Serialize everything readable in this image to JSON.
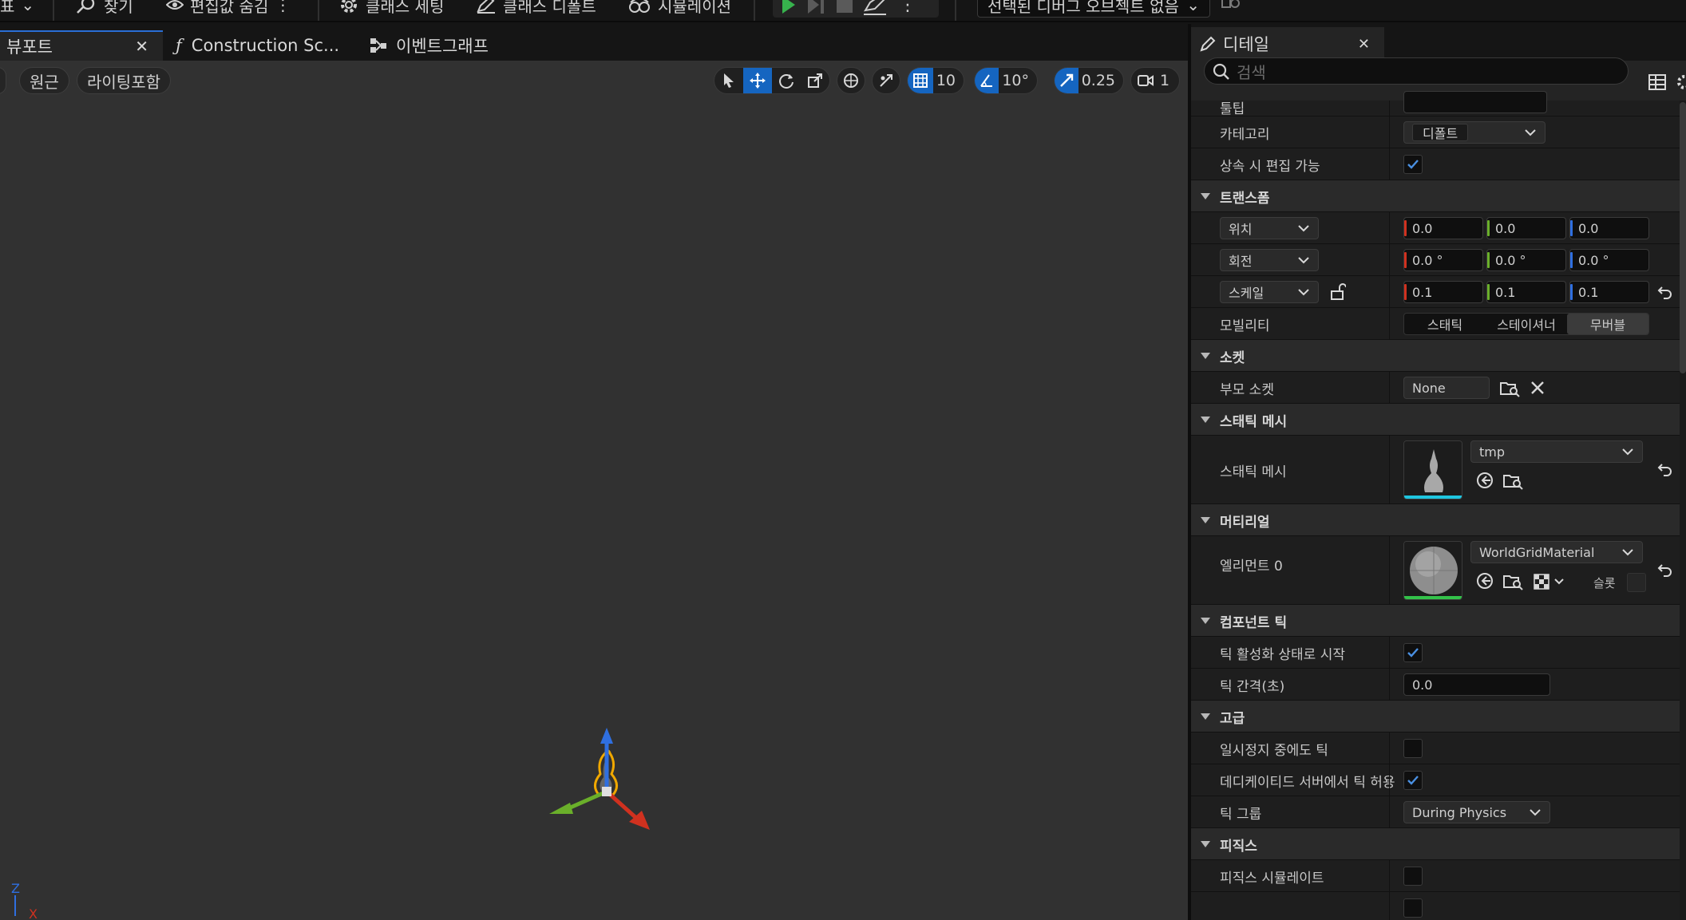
{
  "toolbar": {
    "partial_left": "표",
    "find_label": "찾기",
    "hide_defaults_label": "편집값 숨김",
    "class_settings_label": "클래스 세팅",
    "class_defaults_label": "클래스 디폴트",
    "simulation_label": "시뮬레이션",
    "debug_object_label": "선택된 디버그 오브젝트 없음"
  },
  "viewport_tabs": [
    {
      "label": "뷰포트",
      "icon": "close-icon"
    },
    {
      "label": "Construction Sc...",
      "icon": "function-icon"
    },
    {
      "label": "이벤트그래프",
      "icon": "graph-icon"
    }
  ],
  "viewport": {
    "perspective_label": "원근",
    "lit_label": "라이팅포함",
    "grid_snap_value": "10",
    "rotation_snap_value": "10°",
    "scale_snap_value": "0.25",
    "camera_speed_value": "1",
    "axis_z_label": "Z",
    "axis_x_label": "X"
  },
  "details": {
    "tab_label": "디테일",
    "search_placeholder": "검색",
    "tooltip_label": "툴팁",
    "category_label": "카테고리",
    "category_value": "디폴트",
    "editable_inherit_label": "상속 시 편집 가능",
    "transform_header": "트랜스폼",
    "location_label": "위치",
    "rotation_label": "회전",
    "scale_label": "스케일",
    "location": [
      "0.0",
      "0.0",
      "0.0"
    ],
    "rotation": [
      "0.0 °",
      "0.0 °",
      "0.0 °"
    ],
    "scale": [
      "0.1",
      "0.1",
      "0.1"
    ],
    "mobility_label": "모빌리티",
    "mobility_options": [
      "스태틱",
      "스테이셔너",
      "무버블"
    ],
    "mobility_selected": "무버블",
    "socket_header": "소켓",
    "parent_socket_label": "부모 소켓",
    "parent_socket_value": "None",
    "static_mesh_header": "스태틱 메시",
    "static_mesh_label": "스태틱 메시",
    "static_mesh_value": "tmp",
    "materials_header": "머티리얼",
    "element0_label": "엘리먼트 0",
    "element0_value": "WorldGridMaterial",
    "slot_label": "슬롯",
    "component_tick_header": "컴포넌트 틱",
    "start_tick_enabled_label": "틱 활성화 상태로 시작",
    "tick_interval_label": "틱 간격(초)",
    "tick_interval_value": "0.0",
    "advanced_header": "고급",
    "tick_when_paused_label": "일시정지 중에도 틱",
    "tick_on_dedicated_label": "데디케이티드 서버에서 틱 허용",
    "tick_group_label": "틱 그룹",
    "tick_group_value": "During Physics",
    "physics_header": "피직스",
    "simulate_physics_label": "피직스 시뮬레이트"
  },
  "colors": {
    "accent": "#2a6fd6",
    "axis_x": "#d0311f",
    "axis_y": "#6aaf2a",
    "axis_z": "#2f6fe0",
    "play_green": "#37b24d"
  }
}
